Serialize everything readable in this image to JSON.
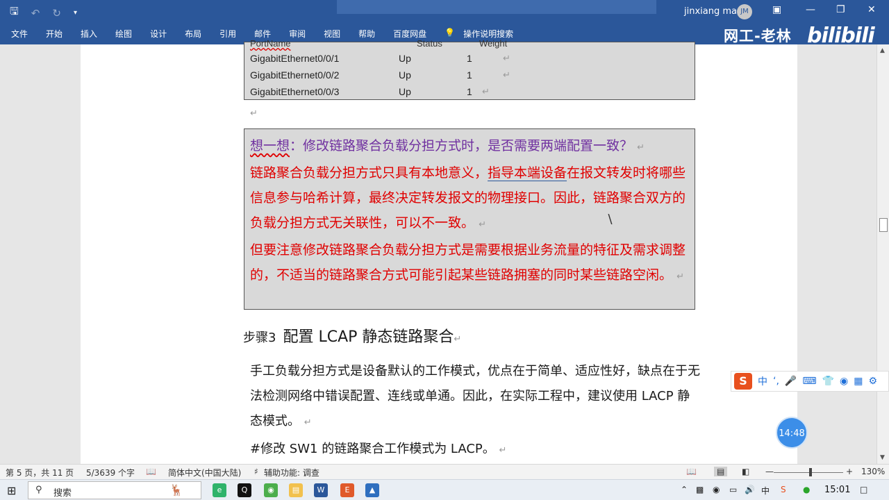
{
  "titlebar": {
    "user_name": "jinxiang ma",
    "avatar_initials": "JM"
  },
  "ribbon": {
    "tabs": [
      "文件",
      "开始",
      "插入",
      "绘图",
      "设计",
      "布局",
      "引用",
      "邮件",
      "审阅",
      "视图",
      "帮助",
      "百度网盘",
      "操作说明搜索"
    ]
  },
  "watermark": {
    "brand": "网工-老林",
    "logo": "bilibili"
  },
  "document": {
    "table_header": {
      "col1": "PortName",
      "col2": "Status",
      "col3": "Weight"
    },
    "table_rows": [
      {
        "port": "GigabitEthernet0/0/1",
        "status": "Up",
        "weight": "1"
      },
      {
        "port": "GigabitEthernet0/0/2",
        "status": "Up",
        "weight": "1"
      },
      {
        "port": "GigabitEthernet0/0/3",
        "status": "Up",
        "weight": "1"
      }
    ],
    "note": {
      "question_prefix": "想一想",
      "question_rest": "：修改链路聚合负载分担方式时，是否需要两端配置一致？",
      "answer1_a": "链路聚合负载分担方式只具有本地意义，",
      "answer1_b": "指导本端设备",
      "answer1_c": "在报文转发时将哪些信息参与哈希计算，最终决定转发报文的物理接口。因此，链路聚合双方的负载分担方式无关联性，可以不一致。",
      "answer2": "但要注意修改链路聚合负载分担方式是需要根据业务流量的特征及需求调整的，不适当的链路聚合方式可能引起某些链路拥塞的同时某些链路空闲。"
    },
    "heading_step": "步骤3",
    "heading_title": "配置 LCAP 静态链路聚合",
    "body_paragraph": "手工负载分担方式是设备默认的工作模式，优点在于简单、适应性好，缺点在于无法检测网络中错误配置、连线或单通。因此，在实际工程中，建议使用 LACP 静态模式。",
    "body_command": "#修改 SW1 的链路聚合工作模式为 LACP。"
  },
  "ime": {
    "logo": "S",
    "lang": "中"
  },
  "clock_bubble": "14:48",
  "statusbar": {
    "page_info": "第 5 页，共 11 页",
    "word_count": "5/3639 个字",
    "language": "简体中文(中国大陆)",
    "accessibility": "辅助功能: 调查",
    "zoom": "130%"
  },
  "taskbar": {
    "search_placeholder": "搜索",
    "time": "15:01"
  }
}
